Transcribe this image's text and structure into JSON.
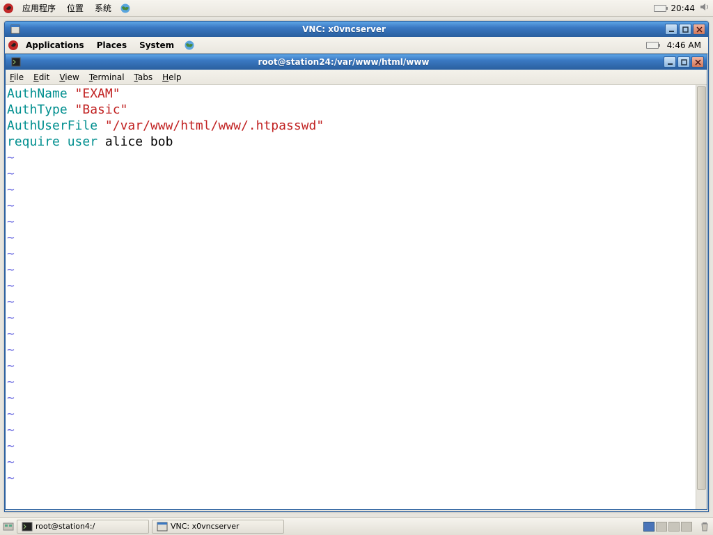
{
  "outer_panel": {
    "menu1": "应用程序",
    "menu2": "位置",
    "menu3": "系统",
    "clock": "20:44"
  },
  "vnc_window": {
    "title": "VNC: x0vncserver"
  },
  "remote_panel": {
    "menu1": "Applications",
    "menu2": "Places",
    "menu3": "System",
    "clock": "4:46 AM"
  },
  "terminal_window": {
    "title": "root@station24:/var/www/html/www",
    "menubar": {
      "file": "File",
      "edit": "Edit",
      "view": "View",
      "terminal": "Terminal",
      "tabs": "Tabs",
      "help": "Help"
    },
    "editor": {
      "lines": {
        "l1_kw": "AuthName",
        "l1_val": "\"EXAM\"",
        "l2_kw": "AuthType",
        "l2_val": "\"Basic\"",
        "l3_kw": "AuthUserFile",
        "l3_val": "\"/var/www/html/www/.htpasswd\"",
        "l4_kw1": "require",
        "l4_kw2": "user",
        "l4_rest": "alice bob"
      }
    }
  },
  "outer_taskbar": {
    "task1": "root@station4:/",
    "task2": "VNC: x0vncserver"
  }
}
